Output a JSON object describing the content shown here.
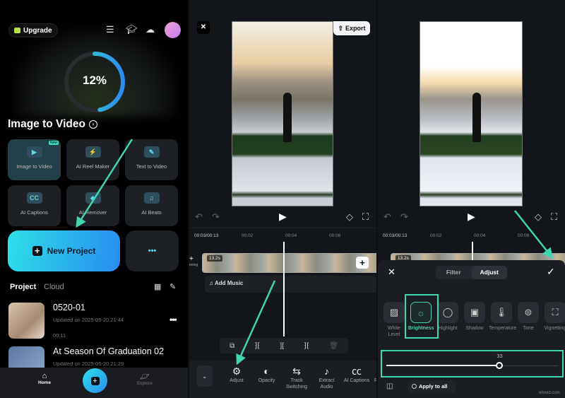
{
  "home": {
    "upgrade_label": "Upgrade",
    "progress_text": "12%",
    "progress_percent": 12,
    "feature_title": "Image to Video",
    "tools": [
      {
        "label": "Image to Video",
        "icon": "image-video-icon",
        "badge": "New"
      },
      {
        "label": "AI Reel Maker",
        "icon": "lightning-icon"
      },
      {
        "label": "Text to Video",
        "icon": "pen-icon"
      },
      {
        "label": "AI Captions",
        "icon": "cc-icon"
      },
      {
        "label": "AI Remover",
        "icon": "eraser-icon"
      },
      {
        "label": "AI Beats",
        "icon": "music-beat-icon"
      }
    ],
    "new_project_label": "New Project",
    "more_label": "•••",
    "tabs": [
      "Project",
      "Cloud"
    ],
    "projects": [
      {
        "title": "0520-01",
        "updated": "Updated on 2025-05-20 21:44",
        "duration": "00:11"
      },
      {
        "title": "At Season Of Graduation 02",
        "updated": "Updated on 2025-05-20 21:29"
      }
    ],
    "nav": {
      "home": "Home",
      "explore": "Explore"
    }
  },
  "editor": {
    "export_label": "Export",
    "ruler": [
      "00:03/00:13",
      "00:02",
      "00:04",
      "00:06"
    ],
    "clip_duration": "13.2s",
    "opening_label": "ening",
    "add_music_label": "Add Music",
    "toolbar": [
      {
        "label": "Adjust",
        "icon": "sliders-icon"
      },
      {
        "label": "Opacity",
        "icon": "opacity-icon"
      },
      {
        "label": "Track Switching",
        "icon": "switch-icon"
      },
      {
        "label": "Extract Audio",
        "icon": "extract-audio-icon"
      },
      {
        "label": "AI Captions",
        "icon": "ai-cc-icon"
      },
      {
        "label": "R"
      }
    ]
  },
  "adjust": {
    "tabs": [
      "Filter",
      "Adjust"
    ],
    "active_tab": "Adjust",
    "options": [
      "White Level",
      "Brightness",
      "Highlight",
      "Shadow",
      "Temperature",
      "Tone",
      "Vignetting"
    ],
    "selected": "Brightness",
    "value": "33",
    "slider_fraction": 0.66,
    "apply_all_label": "Apply to all"
  },
  "accent_color": "#3fd6b0",
  "watermark": "wfxvid.com"
}
